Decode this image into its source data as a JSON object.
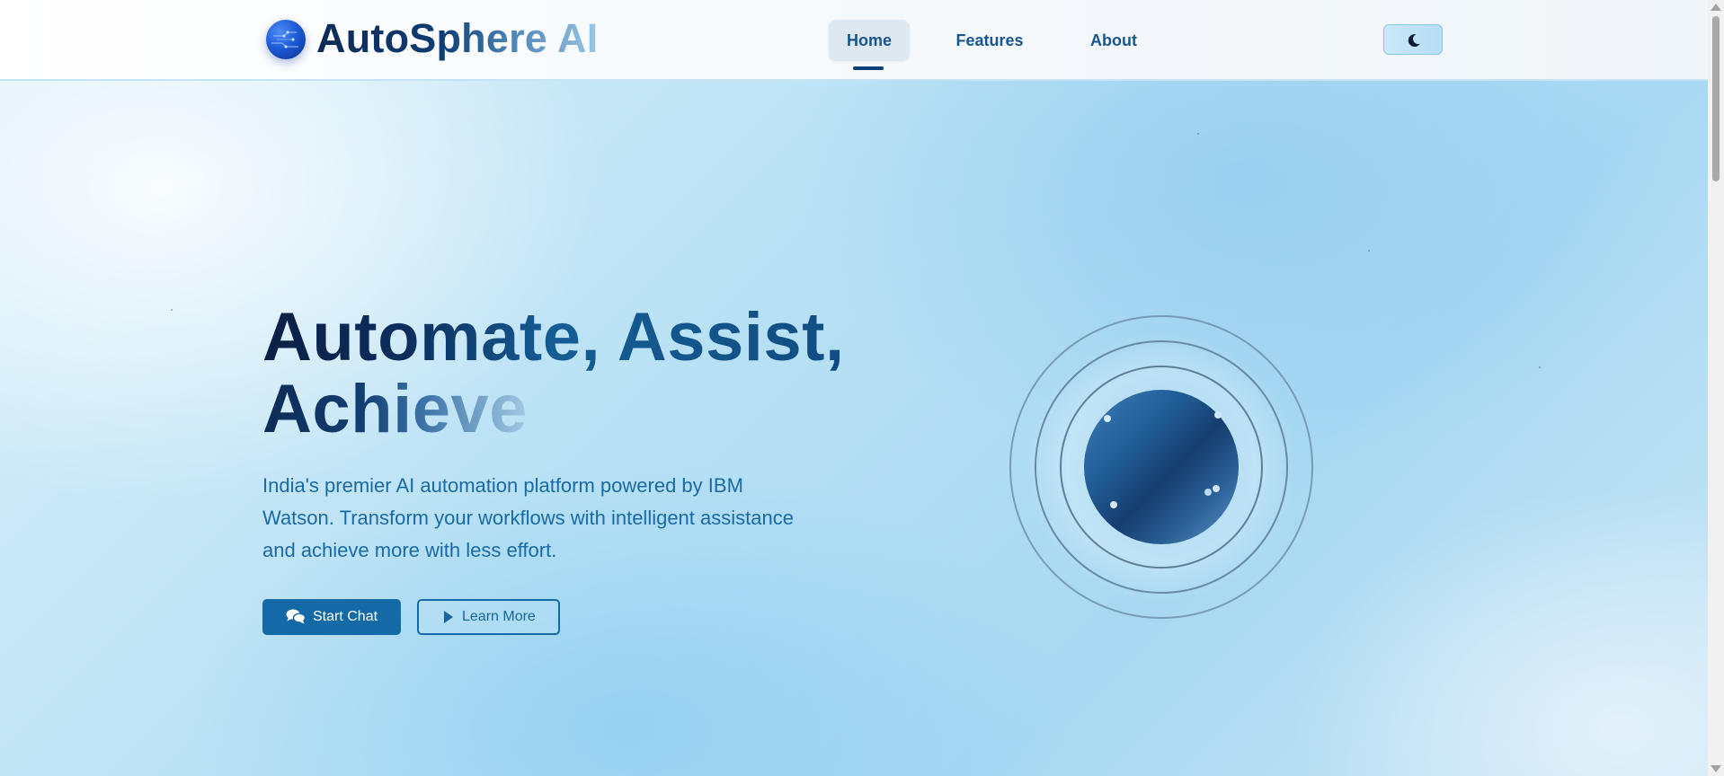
{
  "header": {
    "brand": "AutoSphere AI",
    "nav": [
      {
        "label": "Home",
        "active": true
      },
      {
        "label": "Features",
        "active": false
      },
      {
        "label": "About",
        "active": false
      }
    ],
    "theme_toggle_icon": "moon-icon"
  },
  "hero": {
    "headline_line1": "Automate, Assist,",
    "headline_line2": "Achieve",
    "subtitle": "India's premier AI automation platform powered by IBM Watson. Transform your workflows with intelligent assistance and achieve more with less effort.",
    "primary_button": {
      "label": "Start Chat",
      "icon": "comments-icon"
    },
    "secondary_button": {
      "label": "Learn More",
      "icon": "play-icon"
    }
  },
  "colors": {
    "primary": "#146aa6",
    "dark_navy": "#0d2a57",
    "hero_background": "#b9e1f5"
  }
}
